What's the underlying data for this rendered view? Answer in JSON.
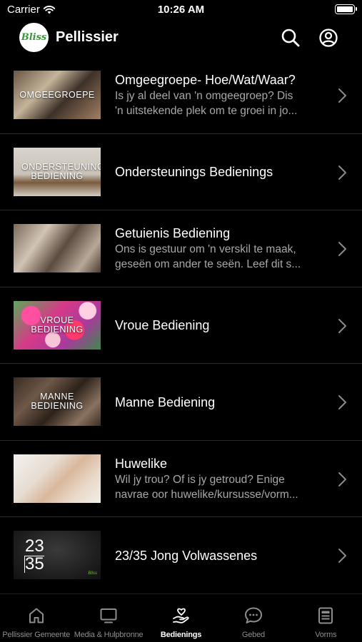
{
  "status_bar": {
    "carrier": "Carrier",
    "time": "10:26 AM"
  },
  "header": {
    "logo_text": "Bliss",
    "title": "Pellissier"
  },
  "items": [
    {
      "thumb_label": "OMGEEGROEPE",
      "title": "Omgeegroepe- Hoe/Wat/Waar?",
      "desc_line1": "Is jy al deel van 'n omgeegroep? Dis",
      "desc_line2": "'n uitstekende plek om te groei in jo..."
    },
    {
      "thumb_label": "ONDERSTEUNINGS BEDIENING",
      "title": "Ondersteunings Bedienings",
      "desc_line1": "",
      "desc_line2": ""
    },
    {
      "thumb_label": "",
      "title": "Getuienis Bediening",
      "desc_line1": "Ons is gestuur om 'n verskil te maak,",
      "desc_line2": "geseën om ander te seën. Leef dit s..."
    },
    {
      "thumb_label": "VROUE BEDIENING",
      "title": "Vroue Bediening",
      "desc_line1": "",
      "desc_line2": ""
    },
    {
      "thumb_label": "MANNE BEDIENING",
      "title": "Manne Bediening",
      "desc_line1": "",
      "desc_line2": ""
    },
    {
      "thumb_label": "",
      "title": "Huwelike",
      "desc_line1": "Wil jy trou? Of is jy getroud? Enige",
      "desc_line2": "navrae oor huwelike/kursusse/vorm..."
    },
    {
      "thumb_label_top": "23",
      "thumb_label_bottom": "35",
      "title": "23/35 Jong Volwassenes",
      "desc_line1": "",
      "desc_line2": ""
    }
  ],
  "tabs": [
    {
      "label": "Pellissier Gemeente",
      "icon": "home-icon",
      "active": false
    },
    {
      "label": "Media & Hulpbronne",
      "icon": "tv-icon",
      "active": false
    },
    {
      "label": "Bedienings",
      "icon": "heart-hand-icon",
      "active": true
    },
    {
      "label": "Gebed",
      "icon": "chat-bubble-icon",
      "active": false
    },
    {
      "label": "Vorms",
      "icon": "form-icon",
      "active": false
    }
  ],
  "colors": {
    "background": "#000000",
    "text_primary": "#ffffff",
    "text_secondary": "#a8a8a8",
    "tab_inactive": "#8d8d8d",
    "logo_green": "#3a9a3a"
  }
}
